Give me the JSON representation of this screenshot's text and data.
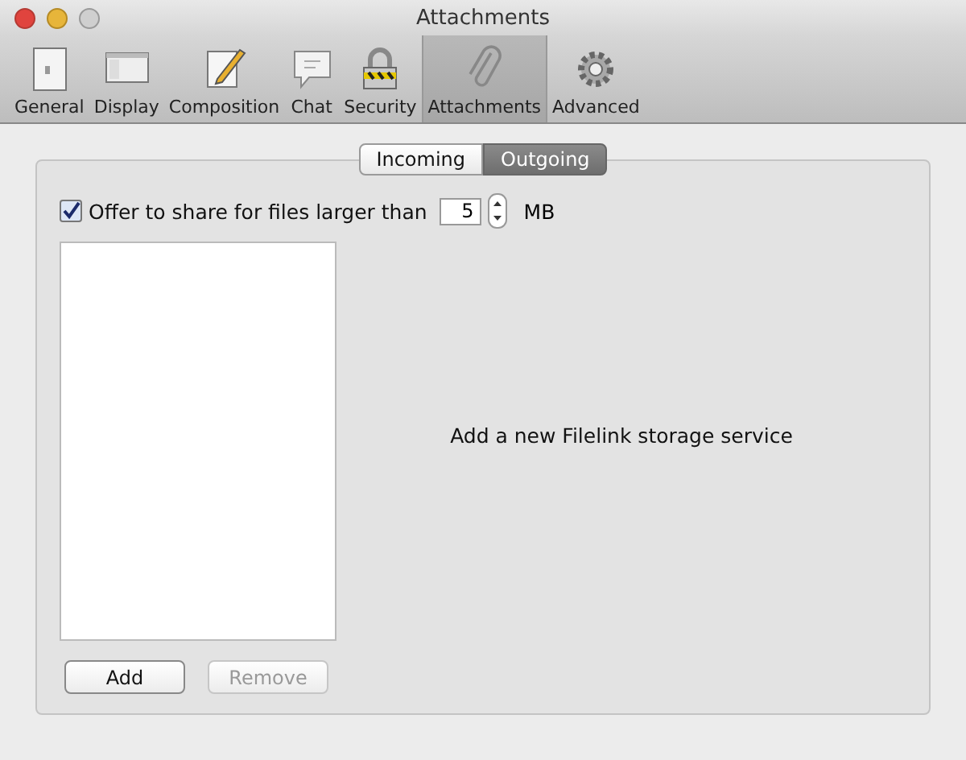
{
  "window": {
    "title": "Attachments"
  },
  "toolbar": [
    {
      "label": "General",
      "selected": false
    },
    {
      "label": "Display",
      "selected": false
    },
    {
      "label": "Composition",
      "selected": false
    },
    {
      "label": "Chat",
      "selected": false
    },
    {
      "label": "Security",
      "selected": false
    },
    {
      "label": "Attachments",
      "selected": true
    },
    {
      "label": "Advanced",
      "selected": false
    }
  ],
  "tabs": [
    {
      "label": "Incoming",
      "selected": false
    },
    {
      "label": "Outgoing",
      "selected": true
    }
  ],
  "share_option": {
    "label": "Offer to share for files larger than",
    "checked": true,
    "value": "5",
    "unit": "MB"
  },
  "service_hint": "Add a new Filelink storage service",
  "buttons": [
    {
      "label": "Add",
      "disabled": false
    },
    {
      "label": "Remove",
      "disabled": true
    }
  ]
}
